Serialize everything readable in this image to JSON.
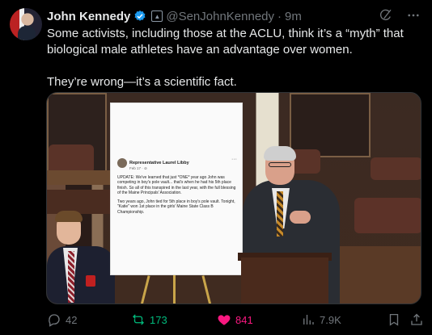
{
  "author": {
    "name": "John Kennedy",
    "handle": "@SenJohnKennedy",
    "separator": "·",
    "time": "9m"
  },
  "tweet": {
    "line1": "Some activists, including those at the ACLU, think it’s a “myth” that biological male athletes have an advantage over women.",
    "line2": "They’re wrong—it’s a scientific fact."
  },
  "poster": {
    "author": "Representative Laurel Libby",
    "date": "Feb 17 · ⊘",
    "more": "···",
    "para1": "UPDATE: We've learned that just *ONE* year ago John was competing in boy's pole vault... that's when he had his 5th place finish. So all of this transpired in the last year, with the full blessing of the Maine Principals' Association.",
    "para2": "Two years ago, John tied for 5th place in boy's pole vault. Tonight, \"Katie\" won 1st place in the girls' Maine State Class B Championship."
  },
  "actions": {
    "replies": "42",
    "reposts": "173",
    "likes": "841",
    "views": "7.9K"
  },
  "icons": {
    "verified": "verified-badge-icon",
    "gov": "government-badge-icon",
    "grok": "grok-icon",
    "more": "more-icon",
    "reply": "reply-icon",
    "repost": "repost-icon",
    "like": "heart-icon",
    "views": "views-icon",
    "bookmark": "bookmark-icon",
    "share": "share-icon"
  },
  "colors": {
    "verified": "#1d9bf0",
    "repost_active": "#00ba7c",
    "like_active": "#f91880",
    "muted": "#71767b",
    "text": "#e7e9ea"
  }
}
